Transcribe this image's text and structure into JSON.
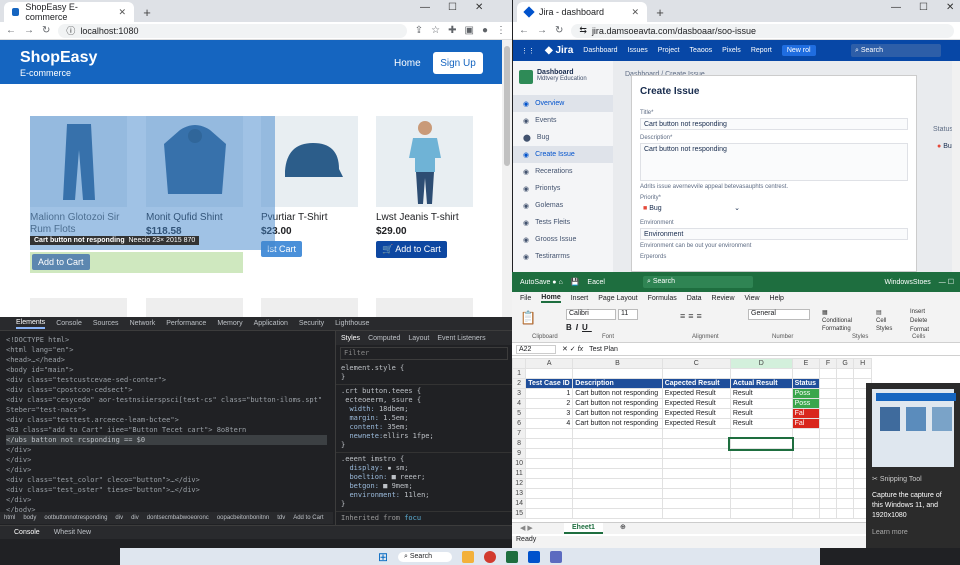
{
  "left_browser": {
    "tab_title": "ShopEasy E-commerce",
    "url": "localhost:1080",
    "site": {
      "brand": "ShopEasy",
      "brand_sub": "E-commerce",
      "nav_home": "Home",
      "nav_signup": "Sign Up",
      "products": [
        {
          "name": "Malionn Glotozoi Sir Rum Flots",
          "price": "",
          "button": "Add to Cart"
        },
        {
          "name": "Monit Qufid Shint",
          "price": "$118.58",
          "button": ""
        },
        {
          "name": "Pvurtiar T-Shirt",
          "price": "$23.00",
          "button": "Ist Cart"
        },
        {
          "name": "Lwst Jeanis T-shirt",
          "price": "$29.00",
          "button": "Add to Cart"
        }
      ],
      "tooltip": "Cart button not responding",
      "tooltip_extra": "Neecio 23× 2015 870"
    },
    "devtools": {
      "tabs": [
        "Elements",
        "Console",
        "Sources",
        "Network",
        "Performance",
        "Memory",
        "Application",
        "Security",
        "Lighthouse"
      ],
      "dom_lines": [
        "<!DOCTYPE html>",
        "<html lang=\"en\">",
        " <head>…</head>",
        " <body id=\"main\">",
        "  <div class=\"testcustcevae-sed-conter\">",
        "   <div class=\"cpostcoo-cedsect\">",
        "    <div class=\"cesycedo\" aor-testnsiierspsci[test-cs\" class=\"button-iloms.spt\"",
        "    Steber=\"test-nacs\">",
        "     <div class=\"testtest.arceece-leam-bctee\">",
        "      <63 class=\"add to Cart\" iiee=\"Button Tecet cart\"> 8o8tern",
        "       </ubs batton not rcsponding  == $0",
        "      </div>",
        "     </div>",
        "    </div>",
        "   <div class=\"test_color\" cleco=\"button\">…</div>",
        "   <div class=\"test_oster\" tiese=\"button\">…</div>",
        "  </div>",
        " </body>",
        "</html>"
      ],
      "styles_tabs": [
        "Styles",
        "Computed",
        "Layout",
        "Event Listeners"
      ],
      "filter": "Filter",
      "breadcrumb": [
        "html",
        "body",
        "ootbuttonnotresponding",
        "div",
        "div",
        "dontsecmbabwoeoronc",
        "oopacbeitonbonitnn",
        "tdv",
        "Add to Cart"
      ],
      "console_tabs": [
        "Console",
        "Whesit New"
      ]
    }
  },
  "right_browser": {
    "tab_title": "Jira - dashboard",
    "url": "jira.damsoeavta.com/dasboaar/soo-issue",
    "nav": [
      "Dashboard",
      "Issues",
      "Project",
      "Teaoos",
      "Pixels",
      "Report"
    ],
    "new_btn": "New rol",
    "search": "Search",
    "side_project": "Dashboard",
    "side_sub": "Mdtvery Education",
    "side_items": [
      "Overview",
      "Events",
      "Bug",
      "Create Issue",
      "Recerations",
      "Priontys",
      "Golemas",
      "Tests Fleits",
      "Grooss Issue",
      "Testirarrms"
    ],
    "breadcrumb": "Dashboard  /  Create Issue",
    "modal": {
      "title": "Create Issue",
      "title_label": "Title*",
      "title_value": "Cart button not responding",
      "desc_label": "Description*",
      "desc_value": "Cart button not responding",
      "desc_hint": "Adrits issue avernevvile appeal betevasauphts centrest.",
      "priority_label": "Priority*",
      "priority_value": "Bug",
      "env_label": "Environment",
      "env_value": "Environment",
      "env_hint": "Environment can be out your environment",
      "more_label": "Erperords"
    },
    "status_label": "Status",
    "status_value": "Bug"
  },
  "excel": {
    "title": "Eacel",
    "search": "Search",
    "user": "WindowsStoes",
    "menu": [
      "File",
      "Home",
      "Insert",
      "Page Layout",
      "Formulas",
      "Data",
      "Review",
      "View",
      "Help"
    ],
    "ribbon_groups": [
      "Clipboard",
      "Font",
      "Alignment",
      "Number",
      "Styles",
      "Cells"
    ],
    "font_name": "Calibri",
    "font_size": "11",
    "number_format": "General",
    "name_box": "A22",
    "formula": "Test Plan",
    "columns": [
      "A",
      "B",
      "C",
      "D",
      "E",
      "F",
      "G",
      "H"
    ],
    "headers": [
      "Test Case ID",
      "Description",
      "Capected Result",
      "Actual Result",
      "Status"
    ],
    "rows": [
      {
        "id": "1",
        "desc": "Cart button not responding",
        "exp": "Expected Result",
        "act": "Result",
        "status": "Poss",
        "color": "#3aa64c"
      },
      {
        "id": "2",
        "desc": "Cart button not responding",
        "exp": "Expected Result",
        "act": "Result",
        "status": "Poss",
        "color": "#3aa64c"
      },
      {
        "id": "3",
        "desc": "Cart button not responding",
        "exp": "Expected Result",
        "act": "Result",
        "status": "Fal",
        "color": "#d9261c"
      },
      {
        "id": "4",
        "desc": "Cart button not responding",
        "exp": "Expected Result",
        "act": "Result",
        "status": "Fal",
        "color": "#d9261c"
      }
    ],
    "sheet_tab": "Eheet1",
    "status_bar": "Ready"
  },
  "snipping": {
    "app": "Snipping Tool",
    "text": "Capture the capture of this Windows 11, and 1920x1080",
    "link": "Learn more"
  },
  "taskbar": {
    "search": "Search"
  }
}
